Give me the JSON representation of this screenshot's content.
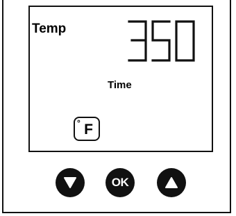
{
  "display": {
    "temp_label": "Temp",
    "temp_value": "350",
    "time_label": "Time",
    "unit_symbol": "F",
    "degree_symbol": "°"
  },
  "buttons": {
    "down_icon": "down-triangle-icon",
    "ok_label": "OK",
    "up_icon": "up-triangle-icon"
  },
  "colors": {
    "ink": "#111111",
    "background": "#ffffff",
    "button_text": "#ffffff"
  }
}
